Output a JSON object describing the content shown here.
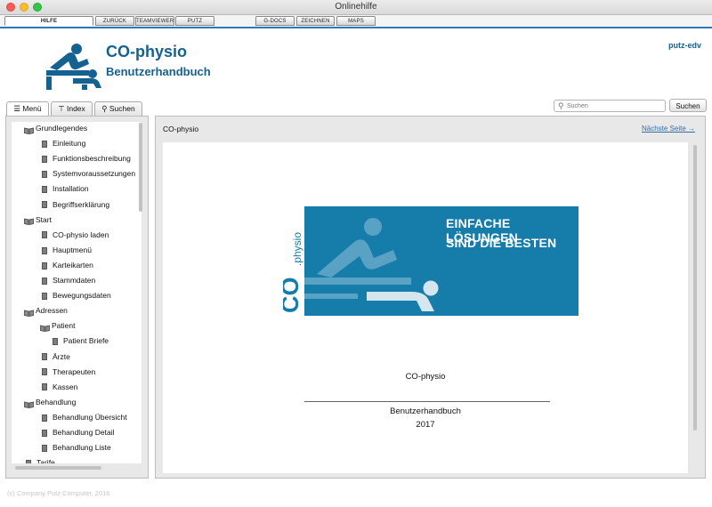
{
  "window": {
    "title": "Onlinehilfe"
  },
  "toolbar": [
    {
      "label": "HILFE",
      "active": true
    },
    {
      "label": "ZURÜCK",
      "active": false
    },
    {
      "label": "TEAMVIEWER",
      "active": false
    },
    {
      "label": "PUTZ",
      "active": false
    },
    {
      "label": "G-DOCS",
      "active": false
    },
    {
      "label": "ZEICHNEN",
      "active": false
    },
    {
      "label": "MAPS",
      "active": false
    }
  ],
  "header": {
    "title": "CO-physio",
    "subtitle": "Benutzerhandbuch",
    "company": "putz-edv"
  },
  "search": {
    "placeholder": "Suchen",
    "button": "Suchen"
  },
  "left_tabs": [
    {
      "label": "Menü",
      "icon": "list-icon"
    },
    {
      "label": "Index",
      "icon": "pin-icon"
    },
    {
      "label": "Suchen",
      "icon": "search-icon"
    }
  ],
  "tree": [
    {
      "label": "Grundlegendes",
      "type": "book",
      "level": 0
    },
    {
      "label": "Einleitung",
      "type": "page",
      "level": 1
    },
    {
      "label": "Funktionsbeschreibung",
      "type": "page",
      "level": 1
    },
    {
      "label": "Systemvoraussetzungen",
      "type": "page",
      "level": 1
    },
    {
      "label": "Installation",
      "type": "page",
      "level": 1
    },
    {
      "label": "Begriffserklärung",
      "type": "page",
      "level": 1
    },
    {
      "label": "Start",
      "type": "book",
      "level": 0
    },
    {
      "label": "CO-physio laden",
      "type": "page",
      "level": 1
    },
    {
      "label": "Hauptmenü",
      "type": "page",
      "level": 1
    },
    {
      "label": "Karteikarten",
      "type": "page",
      "level": 1
    },
    {
      "label": "Stammdaten",
      "type": "page",
      "level": 1
    },
    {
      "label": "Bewegungsdaten",
      "type": "page",
      "level": 1
    },
    {
      "label": "Adressen",
      "type": "book",
      "level": 0
    },
    {
      "label": "Patient",
      "type": "book",
      "level": 1
    },
    {
      "label": "Patient Briefe",
      "type": "page",
      "level": 2
    },
    {
      "label": "Ärzte",
      "type": "page",
      "level": 1
    },
    {
      "label": "Therapeuten",
      "type": "page",
      "level": 1
    },
    {
      "label": "Kassen",
      "type": "page",
      "level": 1
    },
    {
      "label": "Behandlung",
      "type": "book",
      "level": 0
    },
    {
      "label": "Behandlung Übersicht",
      "type": "page",
      "level": 1
    },
    {
      "label": "Behandlung Detail",
      "type": "page",
      "level": 1
    },
    {
      "label": "Behandlung Liste",
      "type": "page",
      "level": 1
    },
    {
      "label": "Tarife",
      "type": "page",
      "level": 0
    }
  ],
  "content": {
    "title": "CO-physio",
    "next_link": "Nächste Seite →",
    "banner_line1": "EINFACHE LÖSUNGEN",
    "banner_line2": "SIND DIE BESTEN",
    "doc_name": "CO-physio",
    "doc_subtitle": "Benutzerhandbuch",
    "doc_year": "2017"
  },
  "footer": {
    "text": "(c) Company Putz Computer, 2016"
  },
  "colors": {
    "brand": "#14628f",
    "banner": "#167ca9",
    "link": "#2f6fa8"
  }
}
